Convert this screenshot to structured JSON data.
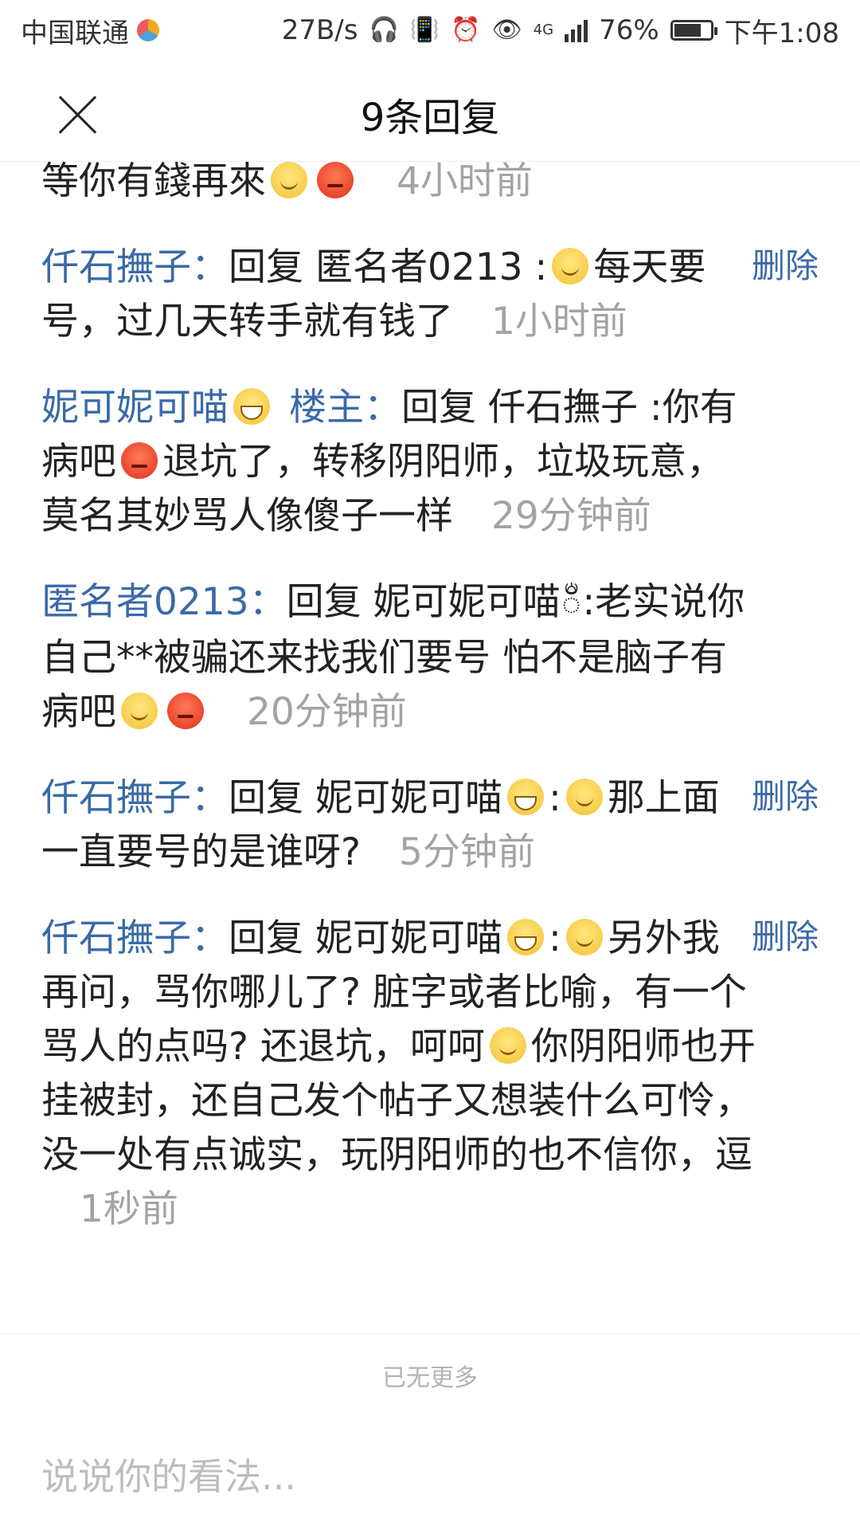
{
  "status_bar": {
    "carrier": "中国联通",
    "speed": "27B/s",
    "battery_percent": "76%",
    "battery_level": 0.76,
    "time": "下午1:08",
    "network": "4G"
  },
  "header": {
    "title": "9条回复"
  },
  "replies": [
    {
      "text": "等你有錢再來",
      "emojis": [
        "smile-emoji",
        "angry-emoji"
      ],
      "time": "4小时前"
    },
    {
      "author": "仟石撫子：",
      "reply_prefix": "回复",
      "reply_to": "匿名者0213 :",
      "text": "每天要号，过几天转手就有钱了",
      "time": "1小时前",
      "delete_label": "删除"
    },
    {
      "author": "妮可妮可喵",
      "floor_label": "楼主：",
      "reply_prefix": "回复",
      "reply_to": "仟石撫子 :你有病吧",
      "text": "退坑了，转移阴阳师，垃圾玩意，莫名其妙骂人像傻子一样",
      "time": "29分钟前"
    },
    {
      "author": "匿名者0213：",
      "reply_prefix": "回复",
      "reply_to": "妮可妮可喵",
      "reply_to_glyph": "ᬁ",
      "text": ":老实说你自己**被骗还来找我们要号 怕不是脑子有病吧",
      "time": "20分钟前"
    },
    {
      "author": "仟石撫子：",
      "reply_prefix": "回复",
      "reply_to": "妮可妮可喵",
      "reply_to_suffix": ":",
      "text": "那上面一直要号的是谁呀?",
      "time": "5分钟前",
      "delete_label": "删除"
    },
    {
      "author": "仟石撫子：",
      "reply_prefix": "回复",
      "reply_to": "妮可妮可喵",
      "reply_to_suffix": ":",
      "text_a": "另外我再问，骂你哪儿了? 脏字或者比喻，有一个骂人的点吗? 还退坑，呵呵",
      "text_b": "你阴阳师也开挂被封，还自己发个帖子又想装什么可怜，没一处有点诚实，玩阴阳师的也不信你，逗",
      "time": "1秒前",
      "delete_label": "删除"
    }
  ],
  "footer": {
    "no_more": "已无更多",
    "input_placeholder": "说说你的看法..."
  },
  "colors": {
    "link_blue": "#3a6aa8",
    "time_gray": "#a3a3a3",
    "text": "#222222"
  }
}
